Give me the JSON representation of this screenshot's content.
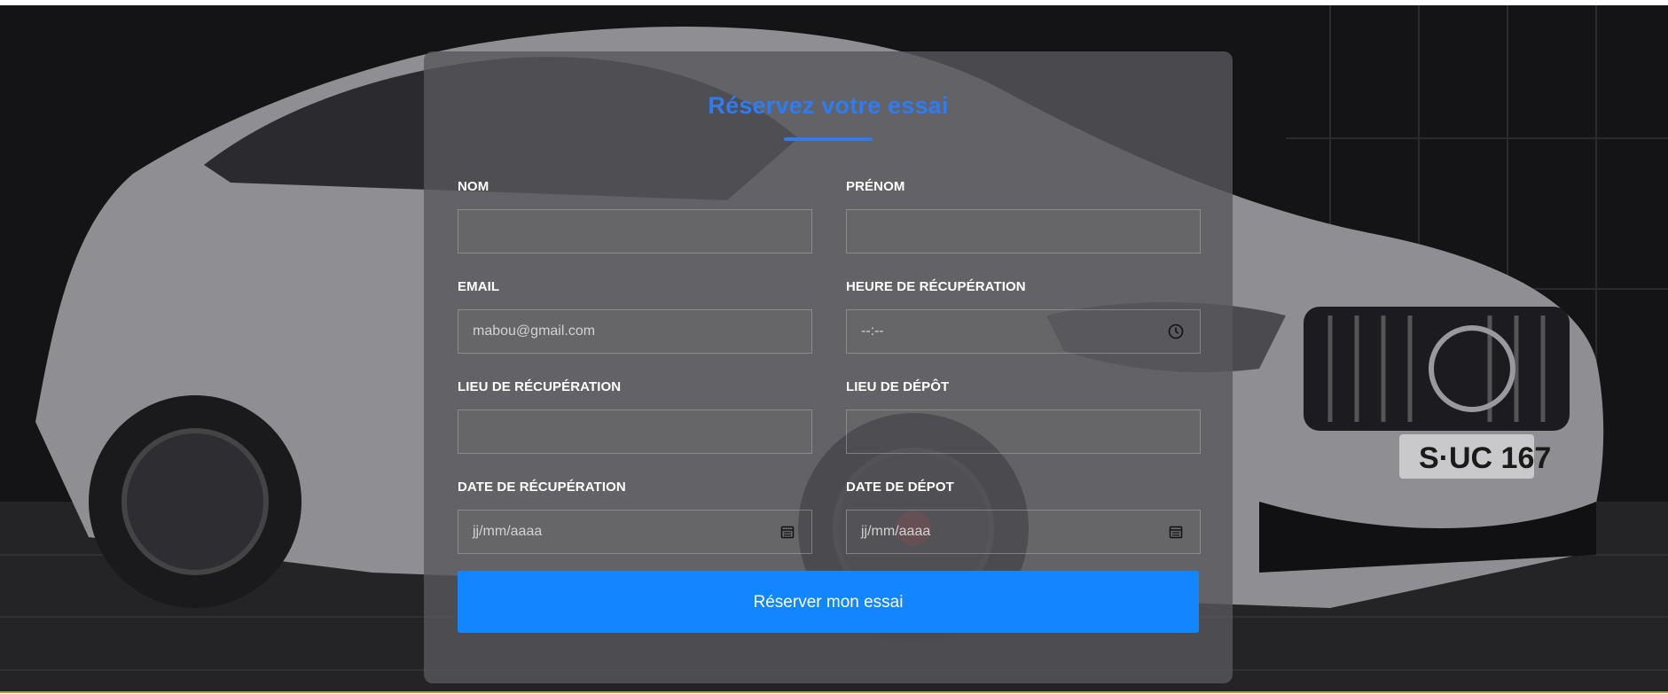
{
  "form": {
    "title": "Réservez votre essai",
    "fields": {
      "nom": {
        "label": "NOM",
        "value": ""
      },
      "prenom": {
        "label": "PRÉNOM",
        "value": ""
      },
      "email": {
        "label": "EMAIL",
        "value": "mabou@gmail.com"
      },
      "heure": {
        "label": "HEURE DE RÉCUPÉRATION",
        "placeholder": "--:--",
        "icon": "clock-icon"
      },
      "lieu_recup": {
        "label": "LIEU DE RÉCUPÉRATION",
        "value": ""
      },
      "lieu_depot": {
        "label": "LIEU DE DÉPÔT",
        "value": ""
      },
      "date_recup": {
        "label": "DATE DE RÉCUPÉRATION",
        "placeholder": "jj/mm/aaaa",
        "icon": "calendar-icon"
      },
      "date_depot": {
        "label": "DATE DE DÉPOT",
        "placeholder": "jj/mm/aaaa",
        "icon": "calendar-icon"
      }
    },
    "submit_label": "Réserver mon essai"
  },
  "background": {
    "license_plate": "S·UC 167"
  },
  "colors": {
    "accent": "#2f7cf0",
    "button": "#1186ff",
    "card": "#58585c",
    "bottom_line": "#b79b45"
  }
}
